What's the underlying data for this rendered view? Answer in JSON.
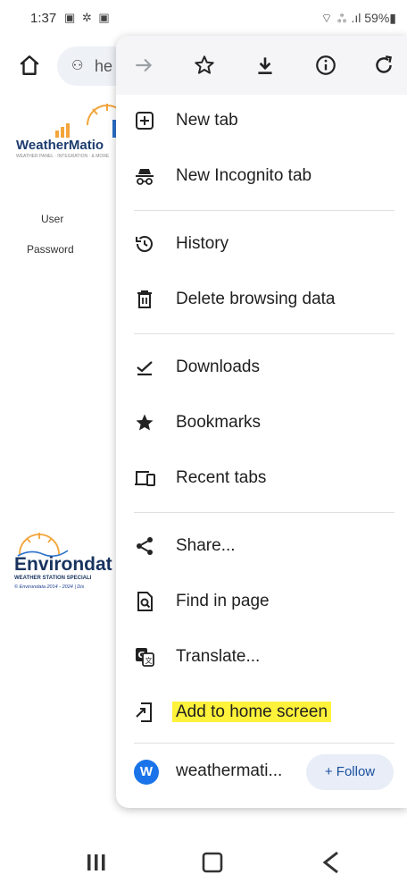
{
  "status_bar": {
    "time": "1:37",
    "left_icons": "▣ ✲ ▣",
    "right_text": "⌔ ⁂ .ıl 59%▮"
  },
  "toolbar": {
    "url_text": "he"
  },
  "page": {
    "logo_brand": "WeatherMatio",
    "logo_sub": "WEATHER PANEL · INTEGRATION · & MORE",
    "user_label": "User",
    "password_label": "Password",
    "footer_brand": "Environdat",
    "footer_tag": "WEATHER STATION SPECIALI",
    "footer_copy": "© Environdata 2014 - 2024 | Dis"
  },
  "menu": {
    "top_icons": [
      "forward-icon",
      "star-icon",
      "download-icon",
      "info-icon",
      "refresh-icon"
    ],
    "items": [
      {
        "label": "New tab",
        "icon": "new-tab-icon"
      },
      {
        "label": "New Incognito tab",
        "icon": "incognito-icon"
      },
      {
        "label": "History",
        "icon": "history-icon"
      },
      {
        "label": "Delete browsing data",
        "icon": "trash-icon"
      },
      {
        "label": "Downloads",
        "icon": "downloads-icon"
      },
      {
        "label": "Bookmarks",
        "icon": "bookmarks-star-icon"
      },
      {
        "label": "Recent tabs",
        "icon": "recent-tabs-icon"
      },
      {
        "label": "Share...",
        "icon": "share-icon"
      },
      {
        "label": "Find in page",
        "icon": "find-in-page-icon"
      },
      {
        "label": "Translate...",
        "icon": "translate-icon"
      },
      {
        "label": "Add to home screen",
        "icon": "add-to-home-icon"
      }
    ],
    "site": {
      "avatar_letter": "W",
      "name": "weathermati...",
      "follow_label": "+ Follow"
    },
    "highlight_color": "#fff23a"
  }
}
